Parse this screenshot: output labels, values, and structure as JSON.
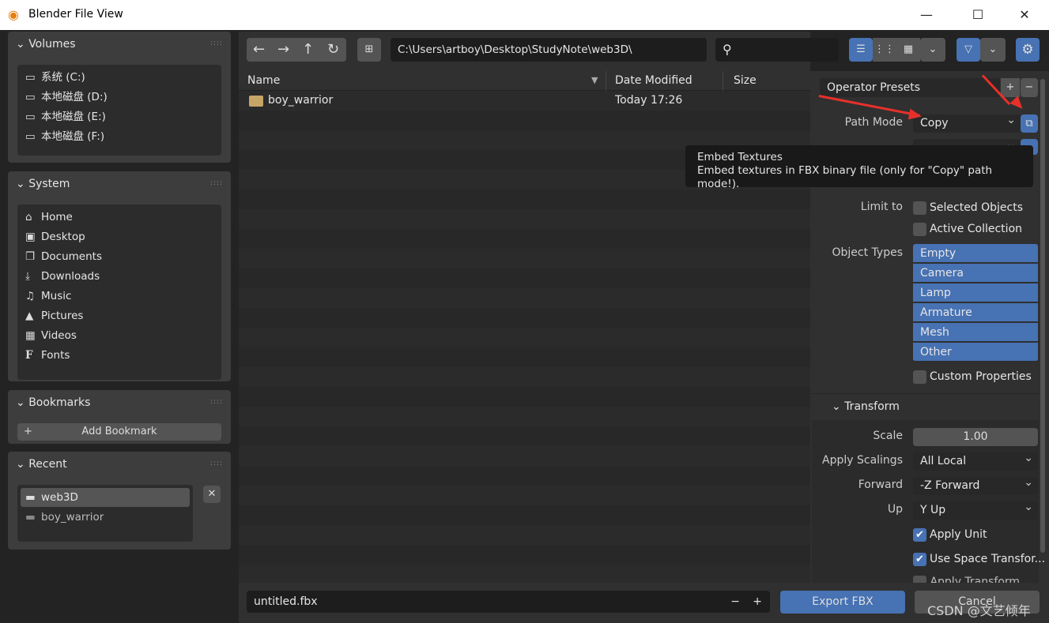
{
  "window": {
    "title": "Blender File View",
    "minimize": "—",
    "maximize": "☐",
    "close": "✕"
  },
  "sidebar": {
    "volumes": {
      "title": "Volumes",
      "items": [
        {
          "label": "系统 (C:)"
        },
        {
          "label": "本地磁盘 (D:)"
        },
        {
          "label": "本地磁盘 (E:)"
        },
        {
          "label": "本地磁盘 (F:)"
        }
      ]
    },
    "system": {
      "title": "System",
      "items": [
        {
          "label": "Home",
          "icon": "home-icon"
        },
        {
          "label": "Desktop",
          "icon": "desktop-icon"
        },
        {
          "label": "Documents",
          "icon": "documents-icon"
        },
        {
          "label": "Downloads",
          "icon": "download-icon"
        },
        {
          "label": "Music",
          "icon": "music-icon"
        },
        {
          "label": "Pictures",
          "icon": "image-icon"
        },
        {
          "label": "Videos",
          "icon": "video-icon"
        },
        {
          "label": "Fonts",
          "icon": "font-icon"
        }
      ]
    },
    "bookmarks": {
      "title": "Bookmarks",
      "add_label": "Add Bookmark"
    },
    "recent": {
      "title": "Recent",
      "items": [
        {
          "label": "web3D"
        },
        {
          "label": "boy_warrior"
        }
      ]
    }
  },
  "toolbar": {
    "path": "C:\\Users\\artboy\\Desktop\\StudyNote\\web3D\\",
    "search_placeholder": ""
  },
  "file_list": {
    "columns": [
      "Name",
      "Date Modified",
      "Size"
    ],
    "rows": [
      {
        "name": "boy_warrior",
        "date": "Today 17:26",
        "size": ""
      }
    ]
  },
  "options": {
    "presets_label": "Operator Presets",
    "path_mode_label": "Path Mode",
    "path_mode": "Copy",
    "tooltip_title": "Embed Textures",
    "tooltip_body": "Embed textures in FBX binary file (only for \"Copy\" path mode!).",
    "limit_to_label": "Limit to",
    "selected_objects": "Selected Objects",
    "active_collection": "Active Collection",
    "object_types_label": "Object Types",
    "object_types": [
      "Empty",
      "Camera",
      "Lamp",
      "Armature",
      "Mesh",
      "Other"
    ],
    "custom_properties": "Custom Properties",
    "transform_title": "Transform",
    "scale_label": "Scale",
    "scale": "1.00",
    "apply_scalings_label": "Apply Scalings",
    "apply_scalings": "All Local",
    "forward_label": "Forward",
    "forward": "-Z Forward",
    "up_label": "Up",
    "up": "Y Up",
    "apply_unit": "Apply Unit",
    "use_space_transform": "Use Space Transfor...",
    "apply_transform": "Apply Transform"
  },
  "footer": {
    "filename": "untitled.fbx",
    "export_label": "Export FBX",
    "cancel_label": "Cancel"
  },
  "watermark": "CSDN @文艺倾年",
  "colors": {
    "accent": "#4772b3",
    "arrow": "#e8302a"
  }
}
